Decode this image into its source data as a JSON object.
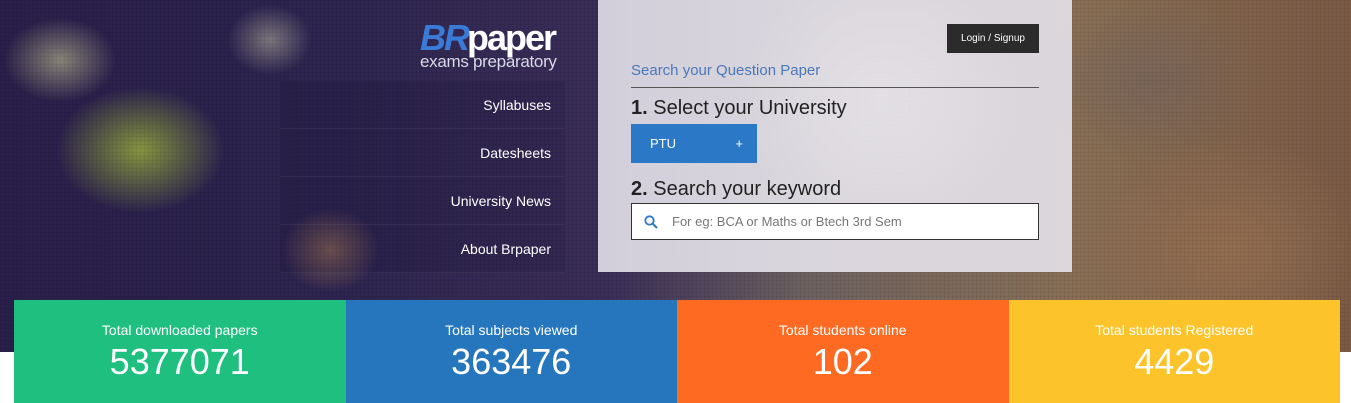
{
  "logo": {
    "br": "BR",
    "paper": "paper",
    "tagline": "exams preparatory"
  },
  "nav": {
    "items": [
      {
        "label": "Syllabuses"
      },
      {
        "label": "Datesheets"
      },
      {
        "label": "University News"
      },
      {
        "label": "About Brpaper"
      }
    ]
  },
  "panel": {
    "login_label": "Login / Signup",
    "search_title": "Search your Question Paper",
    "step1_num": "1.",
    "step1_text": " Select your University",
    "university_selected": "PTU",
    "university_plus": "+",
    "step2_num": "2.",
    "step2_text": " Search your keyword",
    "search_placeholder": "For eg: BCA or Maths or Btech 3rd Sem",
    "search_value": ""
  },
  "stats": [
    {
      "label": "Total downloaded papers",
      "value": "5377071",
      "color": "#1fc07f"
    },
    {
      "label": "Total subjects viewed",
      "value": "363476",
      "color": "#2676bd"
    },
    {
      "label": "Total students online",
      "value": "102",
      "color": "#ff6a22"
    },
    {
      "label": "Total students Registered",
      "value": "4429",
      "color": "#fcc42a"
    }
  ],
  "icons": {
    "search": "search-icon"
  }
}
